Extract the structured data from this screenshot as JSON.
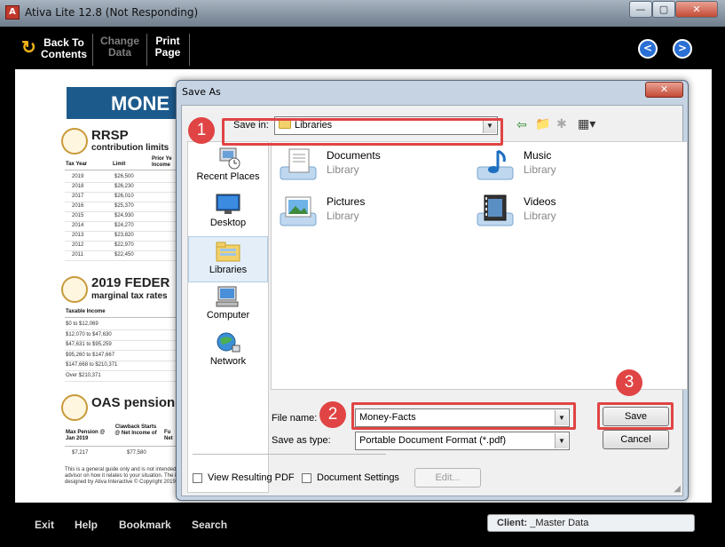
{
  "window": {
    "title": "Ativa Lite 12.8 (Not Responding)",
    "min_glyph": "—",
    "max_glyph": "▢",
    "close_glyph": "✕"
  },
  "toolbar": {
    "back_line1": "Back To",
    "back_line2": "Contents",
    "change_line1": "Change",
    "change_line2": "Data",
    "print_line1": "Print",
    "print_line2": "Page",
    "prev_glyph": "<",
    "next_glyph": ">"
  },
  "document": {
    "banner": "MONE",
    "rrsp_title": "RRSP",
    "rrsp_sub": "contribution limits",
    "rrsp_headers": [
      "Tax Year",
      "Limit",
      "Prior Ye\nIncome"
    ],
    "rrsp_rows": [
      [
        "2019",
        "$26,500"
      ],
      [
        "2018",
        "$26,230"
      ],
      [
        "2017",
        "$26,010"
      ],
      [
        "2016",
        "$25,370"
      ],
      [
        "2015",
        "$24,930"
      ],
      [
        "2014",
        "$24,270"
      ],
      [
        "2013",
        "$23,820"
      ],
      [
        "2012",
        "$22,970"
      ],
      [
        "2011",
        "$22,450"
      ]
    ],
    "fed_title": "2019 FEDER",
    "fed_sub": "marginal tax rates",
    "fed_header": "Taxable Income",
    "fed_rows": [
      "$0 to $12,069",
      "$12,070 to $47,630",
      "$47,631 to $95,259",
      "$95,260 to $147,667",
      "$147,668 to $210,371",
      "Over $210,371"
    ],
    "oas_title": "OAS pension",
    "oas_headers": [
      "Max Pension @ Jan 2019",
      "Clawback Starts @ Net Income of",
      "Fu Net"
    ],
    "oas_values": [
      "$7,217",
      "$77,580"
    ],
    "disclaimer1": "This is a general guide only and is not intended to rep",
    "disclaimer2": "advisor on how it relates to your situation. The informa",
    "disclaimer3": "designed by Ativa Interactive © Copyright 2019. All R"
  },
  "footer": {
    "exit": "Exit",
    "help": "Help",
    "bookmark": "Bookmark",
    "search": "Search",
    "client_label": "Client:",
    "client_value": "_Master Data"
  },
  "dialog": {
    "title": "Save As",
    "close_glyph": "✕",
    "save_in_label": "Save in:",
    "save_in_value": "Libraries",
    "places": [
      {
        "label": "Recent Places"
      },
      {
        "label": "Desktop"
      },
      {
        "label": "Libraries"
      },
      {
        "label": "Computer"
      },
      {
        "label": "Network"
      }
    ],
    "libraries": [
      {
        "name": "Documents",
        "type": "Library"
      },
      {
        "name": "Music",
        "type": "Library"
      },
      {
        "name": "Pictures",
        "type": "Library"
      },
      {
        "name": "Videos",
        "type": "Library"
      }
    ],
    "file_name_label": "File name:",
    "file_name_value": "Money-Facts",
    "save_type_label": "Save as type:",
    "save_type_value": "Portable Document Format (*.pdf)",
    "save_button": "Save",
    "cancel_button": "Cancel",
    "view_pdf_label": "View Resulting PDF",
    "doc_settings_label": "Document Settings",
    "edit_button": "Edit...",
    "callouts": [
      "1",
      "2",
      "3"
    ],
    "callout_color": "#e04444"
  }
}
